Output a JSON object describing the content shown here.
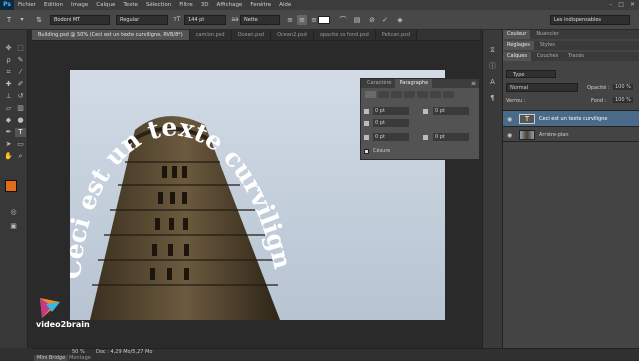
{
  "app": {
    "logo": "Ps"
  },
  "menu": [
    "Fichier",
    "Edition",
    "Image",
    "Calque",
    "Texte",
    "Sélection",
    "Filtre",
    "3D",
    "Affichage",
    "Fenêtre",
    "Aide"
  ],
  "options": {
    "font_family": "Bodoni MT",
    "font_style": "Regular",
    "font_size": "144 pt",
    "antialias": "Nette",
    "workspace": "Les indispensables"
  },
  "tabs": [
    {
      "label": "Building.psd @ 50% (Ceci est un texte curviligne, RVB/8*)"
    },
    {
      "label": "camion.psd"
    },
    {
      "label": "Ocean.psd"
    },
    {
      "label": "Ocean2.psd"
    },
    {
      "label": "opacite vs fond.psd"
    },
    {
      "label": "Pelican.psd"
    }
  ],
  "canvas_text": "Ceci est un texte curviligne",
  "float_panel": {
    "tab_char": "Caractère",
    "tab_para": "Paragraphe",
    "fields": [
      "0 pt",
      "0 pt",
      "0 pt",
      "0 pt",
      "0 pt"
    ],
    "hyphen_label": "Césure"
  },
  "right_panels": {
    "tabs_top": [
      "Couleur",
      "Nuancier"
    ],
    "tabs_mid": [
      "Réglages",
      "Styles"
    ],
    "tabs_layers": [
      "Calques",
      "Couches",
      "Tracés"
    ],
    "kind_filter": "Type",
    "blend_mode": "Normal",
    "opacity_label": "Opacité :",
    "opacity_value": "100 %",
    "lock_label": "Verrou :",
    "fill_label": "Fond :",
    "fill_value": "100 %",
    "layers": [
      {
        "name": "Ceci est un texte curviligne",
        "selected": true
      },
      {
        "name": "Arrière-plan",
        "selected": false
      }
    ]
  },
  "status": {
    "zoom": "50 %",
    "doc": "Doc : 4,29 Mo/5,27 Mo"
  },
  "bottom_tabs": [
    "Mini Bridge",
    "Montage"
  ],
  "brand": "video2brain",
  "colors": {
    "accent": "#e36c1c",
    "selected_layer": "#4a6a8a"
  }
}
